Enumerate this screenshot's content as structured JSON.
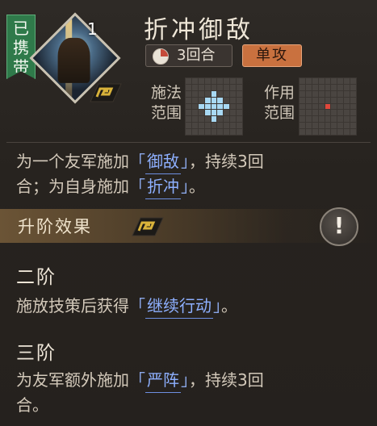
{
  "header": {
    "carried_badge": [
      "已",
      "携",
      "带"
    ],
    "level": "1",
    "title": "折冲御敌",
    "turns": "3回合",
    "type": "单攻"
  },
  "ranges": {
    "cast_label": [
      "施法",
      "范围"
    ],
    "effect_label": [
      "作用",
      "范围"
    ]
  },
  "description": {
    "part1": "为一个友军施加",
    "term1": "御敌",
    "part2": "，持续3回",
    "part3": "合；为自身施加",
    "term2": "折冲",
    "part4": "。"
  },
  "upgrade": {
    "label": "升阶效果",
    "alert": "!"
  },
  "stage2": {
    "title": "二阶",
    "text1": "施放技策后获得",
    "term": "继续行动",
    "text2": "。"
  },
  "stage3": {
    "title": "三阶",
    "text1": "为友军额外施加",
    "term": "严阵",
    "text2": "，持续3回",
    "text3": "合。"
  },
  "colors": {
    "ribbon": "#2f7a4a",
    "type_badge": "#c9713f",
    "term": "#8eb0ff",
    "cast_range": "#a8d9f4",
    "effect_range": "#e0473b"
  }
}
